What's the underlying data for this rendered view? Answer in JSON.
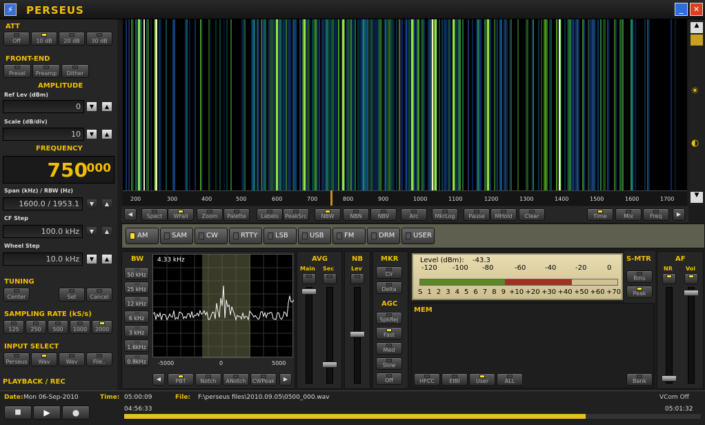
{
  "app": {
    "title": "PERSEUS"
  },
  "att": {
    "label": "ATT",
    "buttons": [
      {
        "label": "Off",
        "on": false
      },
      {
        "label": "10 dB",
        "on": true
      },
      {
        "label": "20 dB",
        "on": false
      },
      {
        "label": "30 dB",
        "on": false
      }
    ]
  },
  "frontend": {
    "label": "FRONT-END",
    "buttons": [
      {
        "label": "Presel",
        "on": false
      },
      {
        "label": "Preamp",
        "on": false
      },
      {
        "label": "Dither",
        "on": false
      }
    ]
  },
  "amplitude": {
    "label": "AMPLITUDE",
    "ref_label": "Ref Lev (dBm)",
    "ref_value": "0",
    "scale_label": "Scale (dB/div)",
    "scale_value": "10"
  },
  "frequency": {
    "label": "FREQUENCY",
    "main": "750",
    "sub": "000",
    "span_label": "Span (kHz) / RBW (Hz)",
    "span_value": "1600.0 / 1953.1",
    "cf_label": "CF Step",
    "cf_value": "100.0 kHz",
    "wheel_label": "Wheel Step",
    "wheel_value": "10.0 kHz"
  },
  "tuning": {
    "label": "TUNING",
    "buttons": [
      "Center",
      "Set",
      "Cancel"
    ]
  },
  "sampling": {
    "label": "SAMPLING RATE (kS/s)",
    "buttons": [
      {
        "label": "125",
        "on": false
      },
      {
        "label": "250",
        "on": false
      },
      {
        "label": "500",
        "on": false
      },
      {
        "label": "1000",
        "on": false
      },
      {
        "label": "2000",
        "on": true
      }
    ]
  },
  "input": {
    "label": "INPUT SELECT",
    "buttons": [
      {
        "label": "Perseus",
        "on": false
      },
      {
        "label": "Wav",
        "on": true
      },
      {
        "label": "Wav",
        "on": false
      },
      {
        "label": "File..",
        "on": false
      }
    ]
  },
  "playback": {
    "label": "PLAYBACK / REC"
  },
  "axis": {
    "ticks": [
      "200",
      "300",
      "400",
      "500",
      "600",
      "700",
      "800",
      "900",
      "1000",
      "1100",
      "1200",
      "1300",
      "1400",
      "1500",
      "1600",
      "1700"
    ]
  },
  "toolbar": {
    "buttons": [
      {
        "label": "Spect",
        "on": false
      },
      {
        "label": "WFall",
        "on": true
      },
      {
        "label": "Zoom",
        "on": false
      },
      {
        "label": "Palette",
        "on": false
      },
      {
        "label": "Labels",
        "on": false
      },
      {
        "label": "PeakSrc",
        "on": false
      },
      {
        "label": "NBW",
        "on": true
      },
      {
        "label": "NBN",
        "on": false
      },
      {
        "label": "NBV",
        "on": false
      },
      {
        "label": "Arc",
        "on": false
      },
      {
        "label": "MkrLog",
        "on": false
      },
      {
        "label": "Pause",
        "on": false
      },
      {
        "label": "MHold",
        "on": false
      },
      {
        "label": "Clear",
        "on": false
      },
      {
        "label": "Time",
        "on": true
      },
      {
        "label": "Mix",
        "on": false
      },
      {
        "label": "Freq",
        "on": false
      }
    ]
  },
  "modes": [
    {
      "label": "AM",
      "on": true
    },
    {
      "label": "SAM",
      "on": false
    },
    {
      "label": "CW",
      "on": false
    },
    {
      "label": "RTTY",
      "on": false
    },
    {
      "label": "LSB",
      "on": false
    },
    {
      "label": "USB",
      "on": false
    },
    {
      "label": "FM",
      "on": false
    },
    {
      "label": "DRM",
      "on": false
    },
    {
      "label": "USER",
      "on": false
    }
  ],
  "bw": {
    "label": "BW",
    "value": "4.33 kHz",
    "buttons": [
      "50 kHz",
      "25 kHz",
      "12 kHz",
      "6 kHz",
      "3 kHz",
      "1.6kHz",
      "0.8kHz"
    ],
    "axis": [
      "-5000",
      "0",
      "5000"
    ],
    "bottom": [
      "PBT",
      "Notch",
      "ANotch",
      "CWPeak"
    ]
  },
  "avg": {
    "label": "AVG",
    "main": "Main",
    "sec": "Sec"
  },
  "nb": {
    "label": "NB",
    "lev": "Lev"
  },
  "mkr": {
    "label": "MKR",
    "buttons": [
      "Clr",
      "Delta"
    ]
  },
  "agc": {
    "label": "AGC",
    "buttons": [
      "SpkRej",
      "Fast",
      "Med",
      "Slow",
      "Off"
    ]
  },
  "level": {
    "label": "Level (dBm):",
    "value": "-43.3",
    "scale": [
      "-120",
      "-100",
      "-80",
      "-60",
      "-40",
      "-20",
      "0"
    ],
    "s": [
      "S",
      "1",
      "2",
      "3",
      "4",
      "5",
      "6",
      "7",
      "8",
      "9",
      "+10",
      "+20",
      "+30",
      "+40",
      "+50",
      "+60",
      "+70"
    ],
    "fill": 0.77
  },
  "smtr": {
    "label": "S-MTR",
    "buttons": [
      "Rms",
      "Peak"
    ]
  },
  "af": {
    "label": "AF",
    "nr": "NR",
    "vol": "Vol"
  },
  "mem": {
    "label": "MEM",
    "buttons": [
      "HFCC",
      "EIBI",
      "User",
      "ALL",
      "Bank"
    ]
  },
  "status": {
    "date_label": "Date:",
    "date": "Mon 06-Sep-2010",
    "time_label": "Time:",
    "time": "05:00:09",
    "file_label": "File:",
    "file": "F:\\perseus files\\2010.09.05\\0500_000.wav",
    "vcom": "VCom Off",
    "elapsed": "04:56:33",
    "remaining": "05:01:32",
    "progress": 0.8
  }
}
